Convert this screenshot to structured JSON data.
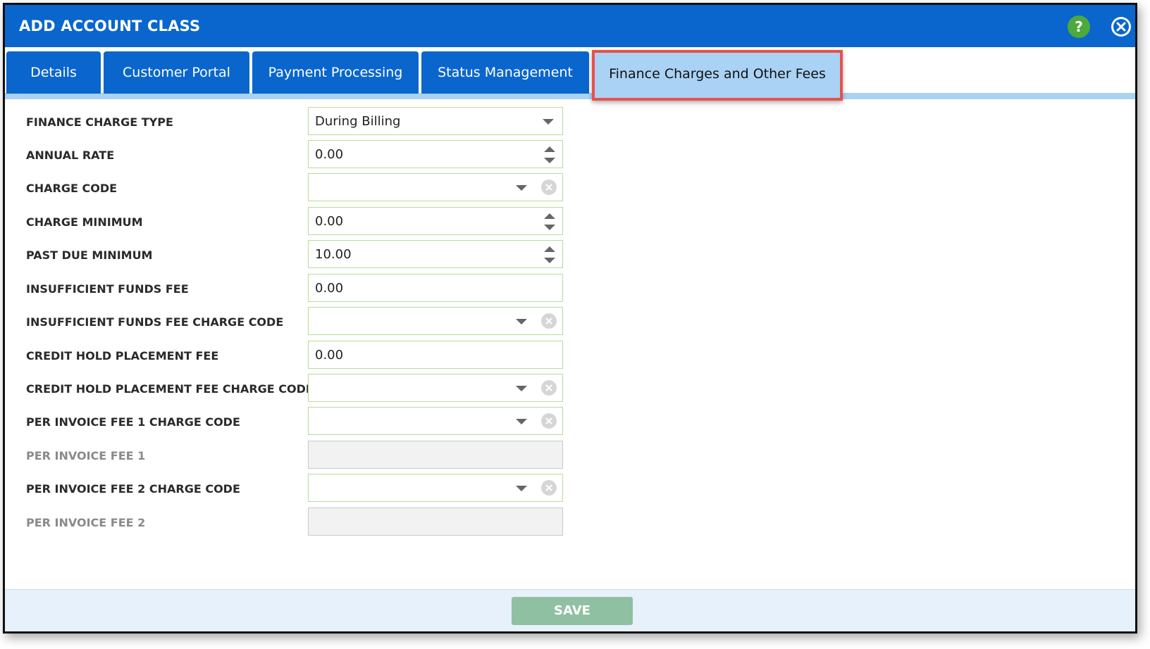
{
  "dialog": {
    "title": "ADD ACCOUNT CLASS",
    "help_icon": "question-icon",
    "close_icon": "close-circle-icon",
    "accent_color": "#0a66cc",
    "help_glyph": "?"
  },
  "tabs": [
    {
      "label": "Details"
    },
    {
      "label": "Customer Portal"
    },
    {
      "label": "Payment Processing"
    },
    {
      "label": "Status Management"
    },
    {
      "label": "Finance Charges and Other Fees",
      "active": true
    }
  ],
  "form": {
    "finance_charge_type": {
      "label": "FINANCE CHARGE TYPE",
      "value": "During Billing"
    },
    "annual_rate": {
      "label": "ANNUAL RATE",
      "value": "0.00"
    },
    "charge_code": {
      "label": "CHARGE CODE",
      "value": ""
    },
    "charge_minimum": {
      "label": "CHARGE MINIMUM",
      "value": "0.00"
    },
    "past_due_minimum": {
      "label": "PAST DUE MINIMUM",
      "value": "10.00"
    },
    "insufficient_funds_fee": {
      "label": "INSUFFICIENT FUNDS FEE",
      "value": "0.00"
    },
    "insufficient_funds_fee_charge_code": {
      "label": "INSUFFICIENT FUNDS FEE CHARGE CODE",
      "value": ""
    },
    "credit_hold_placement_fee": {
      "label": "CREDIT HOLD PLACEMENT FEE",
      "value": "0.00"
    },
    "credit_hold_placement_fee_charge_code": {
      "label": "CREDIT HOLD PLACEMENT FEE CHARGE CODE",
      "value": ""
    },
    "per_invoice_fee_1_charge_code": {
      "label": "PER INVOICE FEE 1 CHARGE CODE",
      "value": ""
    },
    "per_invoice_fee_1": {
      "label": "PER INVOICE FEE 1",
      "value": ""
    },
    "per_invoice_fee_2_charge_code": {
      "label": "PER INVOICE FEE 2 CHARGE CODE",
      "value": ""
    },
    "per_invoice_fee_2": {
      "label": "PER INVOICE FEE 2",
      "value": ""
    }
  },
  "footer": {
    "save_label": "SAVE"
  }
}
